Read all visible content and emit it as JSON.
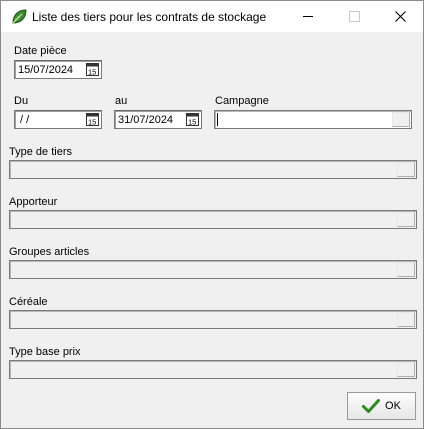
{
  "window": {
    "title": "Liste des tiers pour les contrats de stockage",
    "icon": "app-leaf-icon",
    "controls": [
      "minimize-icon",
      "maximize-icon",
      "close-icon"
    ]
  },
  "form": {
    "date_piece": {
      "label": "Date pièce",
      "value": "15/07/2024"
    },
    "du": {
      "label": "Du",
      "value": " / /"
    },
    "au": {
      "label": "au",
      "value": "31/07/2024"
    },
    "campagne": {
      "label": "Campagne",
      "value": ""
    },
    "type_tiers": {
      "label": "Type de tiers",
      "value": ""
    },
    "apporteur": {
      "label": "Apporteur",
      "value": ""
    },
    "groupes_articles": {
      "label": "Groupes articles",
      "value": ""
    },
    "cereale": {
      "label": "Céréale",
      "value": ""
    },
    "type_base_prix": {
      "label": "Type base prix",
      "value": ""
    }
  },
  "buttons": {
    "ok_label": "OK",
    "ok_icon": "checkmark-icon"
  },
  "colors": {
    "check_green": "#2e8b1f",
    "window_bg": "#f0f0f0"
  }
}
